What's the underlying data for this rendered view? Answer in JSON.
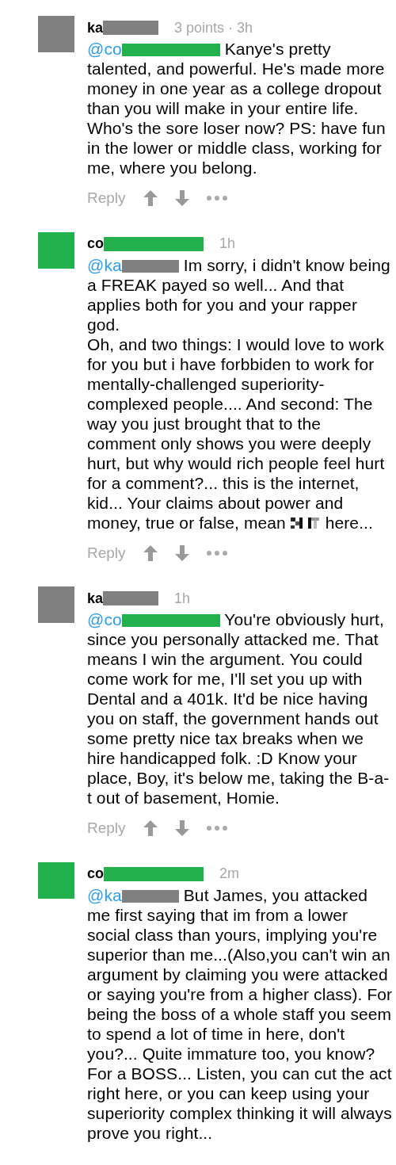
{
  "comments": [
    {
      "color": "#808080",
      "author": {
        "text": "ka",
        "color": "#808080",
        "kind": "short"
      },
      "meta": "3 points · 3h",
      "mention": {
        "text": "@co",
        "color": "#22b14c",
        "kind": "long"
      },
      "body": [
        {
          "kind": "text",
          "text": " Kanye's pretty talented, and powerful. He's made more money in one year as a college dropout than you will make in your entire life. Who's the sore loser now? PS: have fun in the lower or middle class, working for me, where you belong."
        }
      ],
      "reply": "Reply"
    },
    {
      "color": "#22b14c",
      "author": {
        "text": "co",
        "color": "#22b14c",
        "kind": "long"
      },
      "meta": "1h",
      "mention": {
        "text": "@ka",
        "color": "#808080",
        "kind": "short"
      },
      "body": [
        {
          "kind": "text",
          "text": " Im sorry, i didn't know being a FREAK payed so well... And that applies both for you and your rapper god.\nOh, and two things: I would love to work for you but i have forbbiden to work for mentally-challenged superiority-complexed people.... And second: The way you just brought that to the comment only shows you were deeply hurt, but why would rich people feel hurt for a comment?... this is the internet, kid... Your claims about power and money, true or false, mean "
        },
        {
          "kind": "censored"
        },
        {
          "kind": "text",
          "text": " here..."
        }
      ],
      "reply": "Reply"
    },
    {
      "color": "#808080",
      "author": {
        "text": "ka",
        "color": "#808080",
        "kind": "short"
      },
      "meta": "1h",
      "mention": {
        "text": "@co",
        "color": "#22b14c",
        "kind": "long"
      },
      "body": [
        {
          "kind": "text",
          "text": " You're obviously hurt, since you personally attacked me. That means I win the argument. You could come work for me, I'll set you up with Dental and a 401k. It'd be nice having you on staff, the government hands out some pretty nice tax breaks when we hire handicapped folk. :D Know your place, Boy, it's below me, taking the B-a-t out of basement, Homie."
        }
      ],
      "reply": "Reply"
    },
    {
      "color": "#22b14c",
      "author": {
        "text": "co",
        "color": "#22b14c",
        "kind": "long"
      },
      "meta": "2m",
      "mention": {
        "text": "@ka",
        "color": "#808080",
        "kind": "short"
      },
      "body": [
        {
          "kind": "text",
          "text": " But James, you attacked me first saying that im from a lower social class than yours, implying you're superior than me...(Also,you can't win an argument by claiming you were attacked or saying you're from a higher class). For being the boss of a whole staff you seem to spend a lot of time in here, don't you?... Quite immature too, you know? For a BOSS... Listen, you can cut the act right here, or you can keep using your superiority complex thinking it will always prove you right..."
        }
      ]
    }
  ]
}
